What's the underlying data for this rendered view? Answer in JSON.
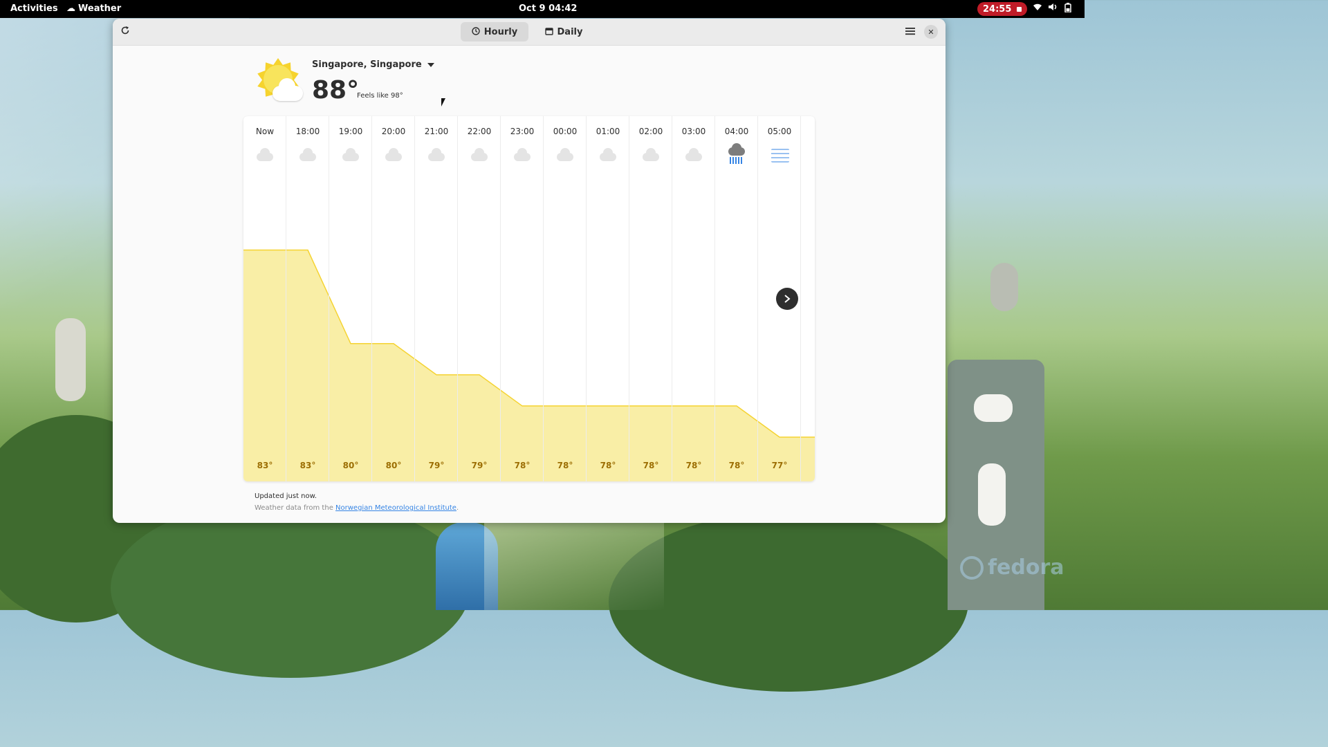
{
  "topbar": {
    "activities": "Activities",
    "app_name": "Weather",
    "clock": "Oct 9  04:42",
    "recording_time": "24:55",
    "tray_icons": [
      "wifi-icon",
      "volume-icon",
      "battery-icon"
    ]
  },
  "header": {
    "tabs": [
      {
        "label": "Hourly",
        "icon": "clock-icon",
        "active": true
      },
      {
        "label": "Daily",
        "icon": "calendar-icon",
        "active": false
      }
    ]
  },
  "current": {
    "location": "Singapore, Singapore",
    "temperature": "88°",
    "feels_like": "Feels like 98°",
    "icon": "sun-with-cloud-icon"
  },
  "forecast": {
    "hours": [
      {
        "time": "Now",
        "icon": "cloud-icon",
        "temp": "83°"
      },
      {
        "time": "18:00",
        "icon": "cloud-icon",
        "temp": "83°"
      },
      {
        "time": "19:00",
        "icon": "cloud-icon",
        "temp": "80°"
      },
      {
        "time": "20:00",
        "icon": "cloud-icon",
        "temp": "80°"
      },
      {
        "time": "21:00",
        "icon": "cloud-icon",
        "temp": "79°"
      },
      {
        "time": "22:00",
        "icon": "cloud-icon",
        "temp": "79°"
      },
      {
        "time": "23:00",
        "icon": "cloud-icon",
        "temp": "78°"
      },
      {
        "time": "00:00",
        "icon": "cloud-icon",
        "temp": "78°"
      },
      {
        "time": "01:00",
        "icon": "cloud-icon",
        "temp": "78°"
      },
      {
        "time": "02:00",
        "icon": "cloud-icon",
        "temp": "78°"
      },
      {
        "time": "03:00",
        "icon": "cloud-icon",
        "temp": "78°"
      },
      {
        "time": "04:00",
        "icon": "rain-icon",
        "temp": "78°"
      },
      {
        "time": "05:00",
        "icon": "fog-icon",
        "temp": "77°"
      }
    ],
    "graph_color": "#f9eea6",
    "graph_line_color": "#f5d331"
  },
  "footer": {
    "updated": "Updated just now.",
    "source_prefix": "Weather data from the ",
    "source_link": "Norwegian Meteorological Institute",
    "source_suffix": "."
  },
  "wallpaper": {
    "brand": "fedora"
  }
}
